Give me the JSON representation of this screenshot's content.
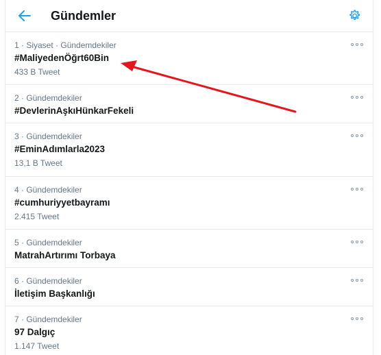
{
  "header": {
    "title": "Gündemler",
    "back_icon": "arrow-left-icon",
    "settings_icon": "gear-icon"
  },
  "colors": {
    "accent": "#1da1f2",
    "muted": "#657786",
    "border": "#e6ecf0",
    "annotation": "#e8141c"
  },
  "trends": [
    {
      "meta": "1 · Siyaset · Gündemdekiler",
      "name": "#MaliyedenÖğrt60Bin",
      "count": "433 B Tweet"
    },
    {
      "meta": "2 · Gündemdekiler",
      "name": "#DevlerinAşkıHünkarFekeli",
      "count": ""
    },
    {
      "meta": "3 · Gündemdekiler",
      "name": "#EminAdımlarla2023",
      "count": "13,1 B Tweet"
    },
    {
      "meta": "4 · Gündemdekiler",
      "name": "#cumhuriyyetbayramı",
      "count": "2.415 Tweet"
    },
    {
      "meta": "5 · Gündemdekiler",
      "name": "MatrahArtırımı Torbaya",
      "count": ""
    },
    {
      "meta": "6 · Gündemdekiler",
      "name": "İletişim Başkanlığı",
      "count": ""
    },
    {
      "meta": "7 · Gündemdekiler",
      "name": "97 Dalgıç",
      "count": "1.147 Tweet"
    }
  ]
}
